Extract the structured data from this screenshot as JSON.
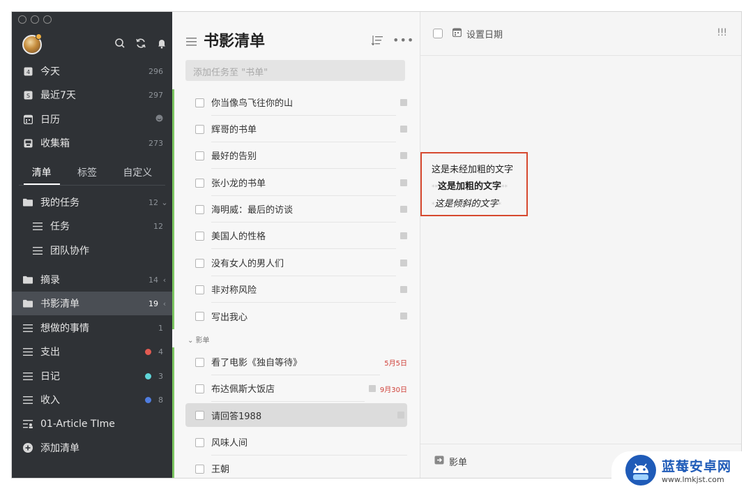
{
  "sidebar": {
    "nav": [
      {
        "label": "今天",
        "count": "296",
        "icon": "calendar-today-icon"
      },
      {
        "label": "最近7天",
        "count": "297",
        "icon": "calendar-week-icon"
      },
      {
        "label": "日历",
        "count": "",
        "icon": "calendar-icon"
      },
      {
        "label": "收集箱",
        "count": "273",
        "icon": "inbox-icon"
      }
    ],
    "tabs": [
      "清单",
      "标签",
      "自定义"
    ],
    "lists": [
      {
        "label": "我的任务",
        "count": "12",
        "icon": "folder-icon"
      },
      {
        "label": "任务",
        "count": "12",
        "icon": "list-icon"
      },
      {
        "label": "团队协作",
        "count": "",
        "icon": "list-icon"
      },
      {
        "label": "摘录",
        "count": "14",
        "icon": "folder-icon"
      },
      {
        "label": "书影清单",
        "count": "19",
        "icon": "folder-icon"
      },
      {
        "label": "想做的事情",
        "count": "1",
        "icon": "list-icon"
      },
      {
        "label": "支出",
        "count": "4",
        "icon": "list-icon",
        "dot": "#e25b52"
      },
      {
        "label": "日记",
        "count": "3",
        "icon": "list-icon",
        "dot": "#5fd6d9"
      },
      {
        "label": "收入",
        "count": "8",
        "icon": "list-icon",
        "dot": "#4f7de0"
      },
      {
        "label": "01-Article TIme",
        "count": "",
        "icon": "article-icon"
      },
      {
        "label": "添加清单",
        "count": "",
        "icon": "add-icon"
      }
    ]
  },
  "list": {
    "title": "书影清单",
    "add_placeholder": "添加任务至 \"书单\"",
    "books": [
      "你当像鸟飞往你的山",
      "辉哥的书单",
      "最好的告别",
      "张小龙的书单",
      "海明威：最后的访谈",
      "美国人的性格",
      "没有女人的男人们",
      "非对称风险",
      "写出我心"
    ],
    "group": "影单",
    "movies": [
      {
        "title": "看了电影《独自等待》",
        "date": "5月5日",
        "note": false
      },
      {
        "title": "布达佩斯大饭店",
        "date": "9月30日",
        "note": true
      },
      {
        "title": "请回答1988",
        "date": "",
        "note": true
      },
      {
        "title": "风味人间",
        "date": "",
        "note": false
      },
      {
        "title": "王朝",
        "date": "",
        "note": false
      }
    ]
  },
  "detail": {
    "set_date": "设置日期",
    "priority": "!!!",
    "line1": "这是未经加粗的文字",
    "line2_marks": "**",
    "line2": "这是加粗的文字",
    "line3_marks": "*",
    "line3": "这是倾斜的文字",
    "footer_list": "影单"
  },
  "watermark": {
    "name": "蓝莓安卓网",
    "url": "www.lmkjst.com"
  },
  "colors": {
    "sidebar_bg": "#2f3236",
    "accent_green": "#7cc661",
    "highlight_border": "#d6492f",
    "date_red": "#d0413a"
  }
}
